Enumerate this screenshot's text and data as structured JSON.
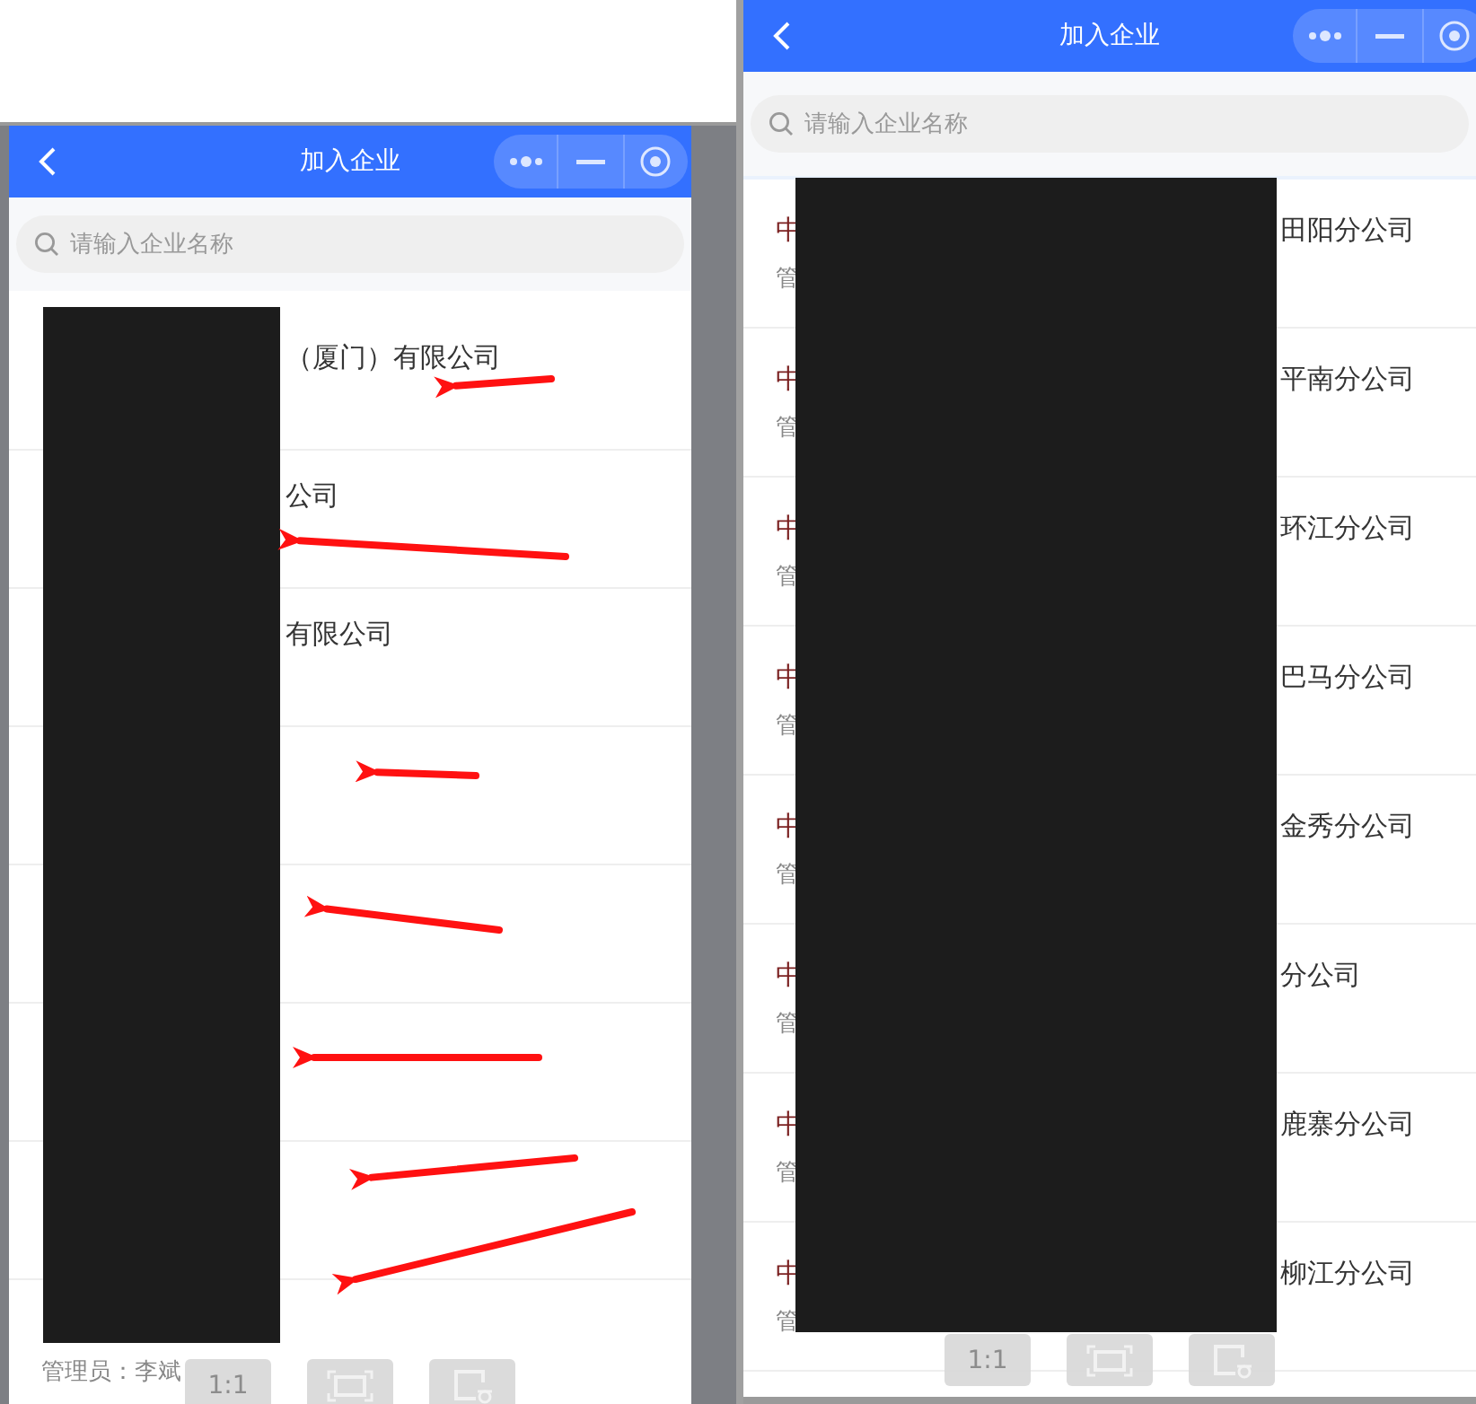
{
  "panels": [
    {
      "title": "加入企业",
      "search": {
        "placeholder": "请输入企业名称"
      },
      "rows": [
        {
          "title_end": "（厦门）有限公司"
        },
        {
          "title_end": "公司"
        },
        {
          "title_end": "有限公司"
        },
        {},
        {},
        {},
        {},
        {
          "admin": "管理员：李斌"
        }
      ],
      "footer_buttons": [
        {
          "kind": "ratio",
          "label": "1:1",
          "disabled": true
        },
        {
          "kind": "fit",
          "disabled": true
        },
        {
          "kind": "crop",
          "disabled": true
        }
      ]
    },
    {
      "title": "加入企业",
      "search": {
        "placeholder": "请输入企业名称"
      },
      "rows": [
        {
          "title_start": "中",
          "title_end": "田阳分公司",
          "admin": "管"
        },
        {
          "title_start": "中",
          "title_end": "平南分公司",
          "admin": "管"
        },
        {
          "title_start": "中",
          "title_end": "环江分公司",
          "admin": "管"
        },
        {
          "title_start": "中",
          "title_end": "巴马分公司",
          "admin": "管"
        },
        {
          "title_start": "中",
          "title_end": "金秀分公司",
          "admin": "管"
        },
        {
          "title_start": "中",
          "title_end": "分公司",
          "admin": "管"
        },
        {
          "title_start": "中",
          "title_end": "鹿寨分公司",
          "admin": "管"
        },
        {
          "title_start": "中",
          "title_end": "柳江分公司",
          "admin": "管"
        }
      ],
      "footer_buttons": [
        {
          "kind": "ratio",
          "label": "1:1",
          "disabled": true
        },
        {
          "kind": "fit",
          "disabled": true
        },
        {
          "kind": "crop",
          "disabled": true
        }
      ]
    }
  ]
}
